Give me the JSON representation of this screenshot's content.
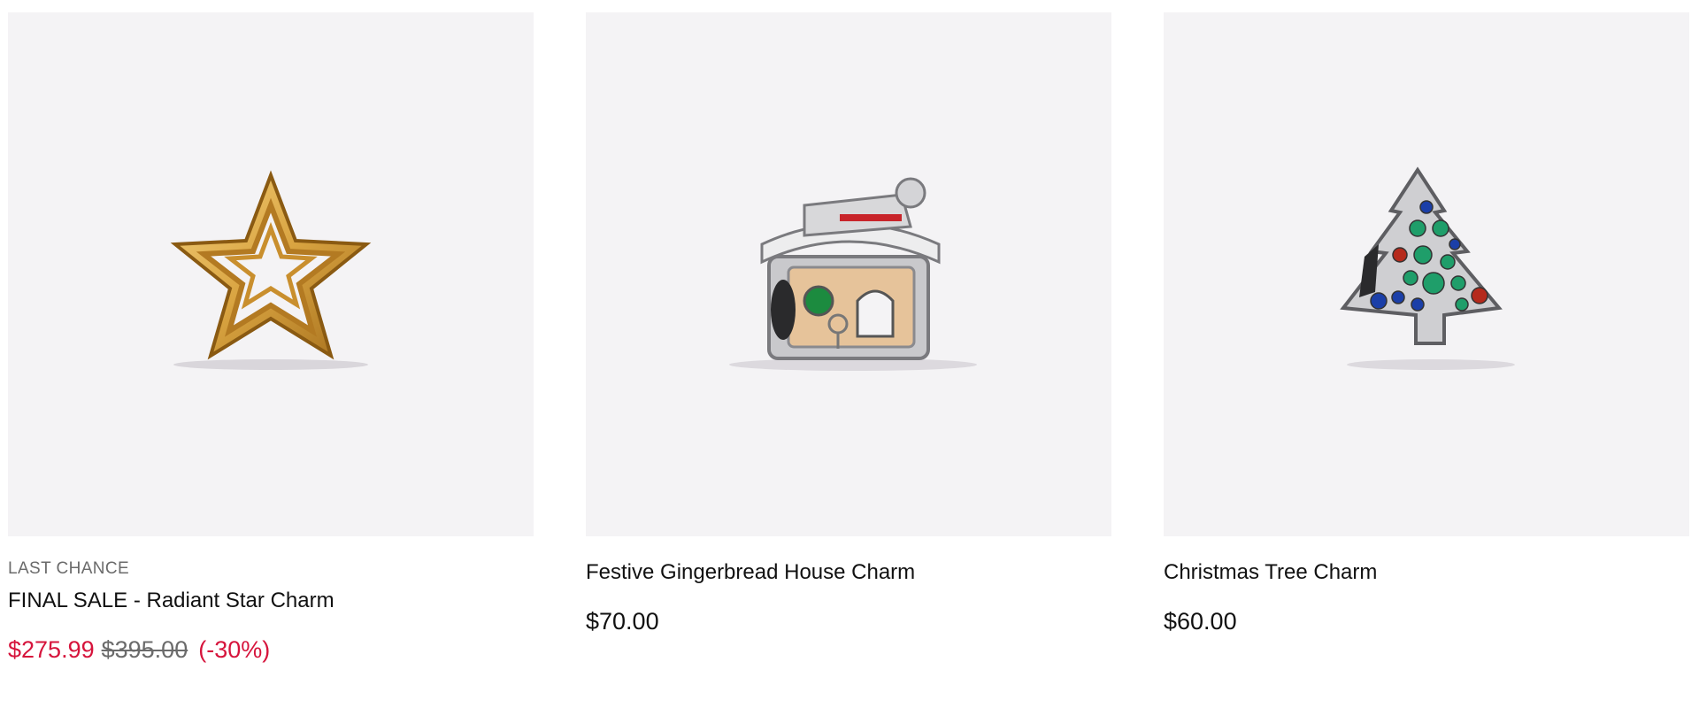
{
  "products": [
    {
      "badge": "LAST CHANCE",
      "name": "FINAL SALE - Radiant Star Charm",
      "sale_price": "$275.99",
      "original_price": "$395.00",
      "discount": "(-30%)",
      "image_icon": "gold-star-charm"
    },
    {
      "name": "Festive Gingerbread House Charm",
      "price": "$70.00",
      "image_icon": "gingerbread-house-charm"
    },
    {
      "name": "Christmas Tree Charm",
      "price": "$60.00",
      "image_icon": "christmas-tree-charm"
    }
  ],
  "colors": {
    "sale_red": "#d6143c",
    "image_bg": "#f4f3f5",
    "gold": "#d9a441",
    "silver": "#c9c9cc",
    "emerald": "#1f9e6a",
    "sapphire": "#1b3fa8",
    "ruby": "#b52a1c"
  }
}
